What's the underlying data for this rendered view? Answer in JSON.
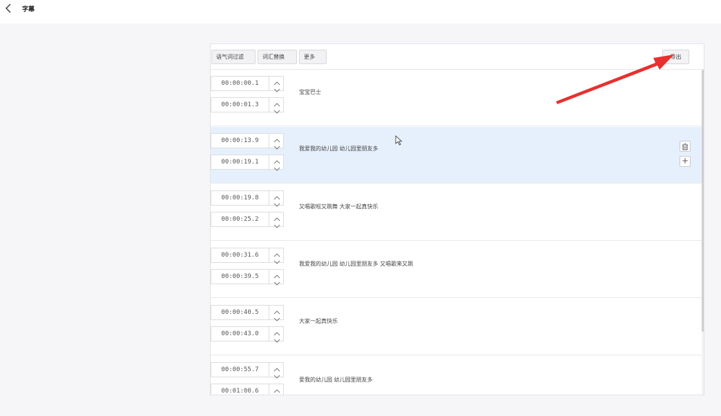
{
  "header": {
    "back_icon": "chevron-left-icon",
    "title": "字幕"
  },
  "toolbar": {
    "filter_label": "语气词过滤",
    "replace_label": "词汇替换",
    "more_label": "更多",
    "export_label": "导出"
  },
  "subtitles": [
    {
      "start": "00:00:00.1",
      "end": "00:00:01.3",
      "text": "宝宝巴士"
    },
    {
      "start": "00:00:13.9",
      "end": "00:00:19.1",
      "text": "我爱我的幼儿园 幼儿园里朋友多"
    },
    {
      "start": "00:00:19.8",
      "end": "00:00:25.2",
      "text": "又唱歌啦又跳舞 大家一起真快乐"
    },
    {
      "start": "00:00:31.6",
      "end": "00:00:39.5",
      "text": "我爱我的幼儿园 幼儿园里朋友多 又唱歌来又跳"
    },
    {
      "start": "00:00:40.5",
      "end": "00:00:43.0",
      "text": "大家一起真快乐"
    },
    {
      "start": "00:00:55.7",
      "end": "00:01:00.6",
      "text": "爱我的幼儿园 幼儿园里朋友多"
    }
  ],
  "row_actions": {
    "delete_icon": "trash-icon",
    "add_label": "+"
  },
  "colors": {
    "selected_row": "#e6f0fd",
    "annotation_arrow": "#e8302e"
  }
}
